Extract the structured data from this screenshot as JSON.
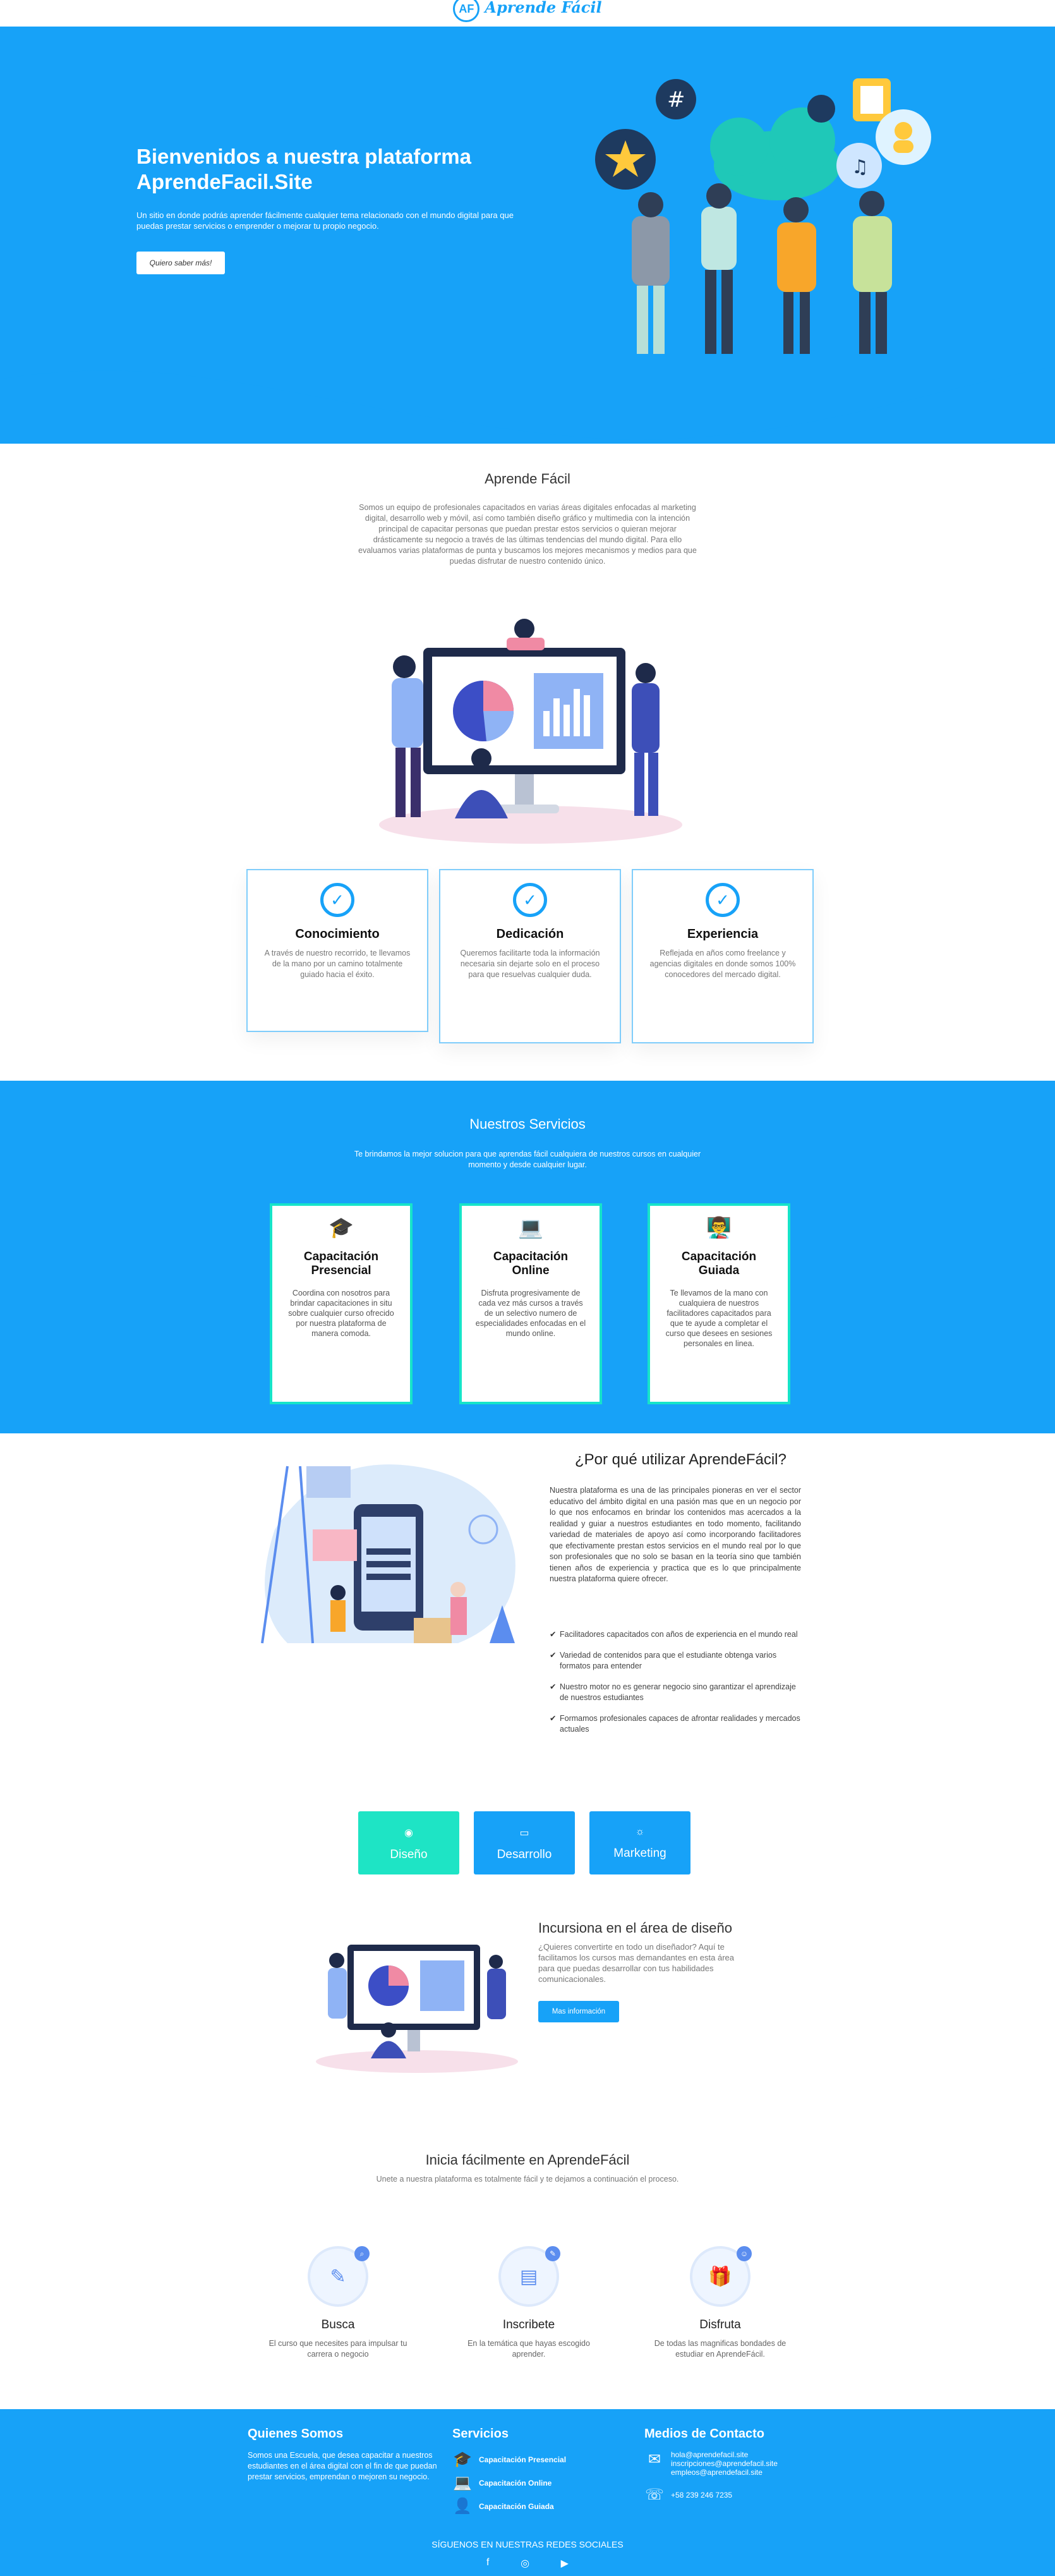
{
  "header": {
    "logo_text": "Aprende Fácil",
    "logo_mark": "AF"
  },
  "hero": {
    "title": "Bienvenidos a nuestra plataforma AprendeFacil.Site",
    "text": "Un sitio en donde podrás aprender fácilmente cualquier tema relacionado con el mundo digital para que puedas prestar servicios o emprender o mejorar tu propio negocio.",
    "button": "Quiero saber más!"
  },
  "about": {
    "title": "Aprende Fácil",
    "text": "Somos un equipo de profesionales capacitados en varias áreas digitales enfocadas al marketing digital, desarrollo web y móvil, así como también diseño gráfico y multimedia con la intención principal de capacitar personas que puedan prestar estos servicios o quieran mejorar drásticamente su negocio a través de las últimas tendencias del mundo digital. Para ello evaluamos varias plataformas de punta y buscamos los mejores mecanismos y medios para que puedas disfrutar de nuestro contenido único."
  },
  "features": [
    {
      "title": "Conocimiento",
      "text": "A través de nuestro recorrido, te llevamos de la mano por un camino totalmente guiado hacia el éxito."
    },
    {
      "title": "Dedicación",
      "text": "Queremos facilitarte toda la información necesaria sin dejarte solo en el proceso para que resuelvas cualquier duda."
    },
    {
      "title": "Experiencia",
      "text": "Reflejada en años como freelance y agencias digitales en donde somos 100% conocedores del mercado digital."
    }
  ],
  "services": {
    "title": "Nuestros Servicios",
    "text": "Te brindamos la mejor solucion para que aprendas fácil cualquiera de nuestros cursos en cualquier momento y desde cualquier lugar.",
    "items": [
      {
        "icon": "graduate-icon",
        "glyph": "🎓",
        "title": "Capacitación Presencial",
        "text": "Coordina con nosotros para brindar capacitaciones in situ sobre cualquier curso ofrecido por nuestra plataforma de manera comoda."
      },
      {
        "icon": "laptop-icon",
        "glyph": "💻",
        "title": "Capacitación Online",
        "text": "Disfruta progresivamente de cada vez más cursos a través de un selectivo numero de especialidades enfocadas en el mundo online."
      },
      {
        "icon": "user-teacher-icon",
        "glyph": "👨‍🏫",
        "title": "Capacitación Guiada",
        "text": "Te llevamos de la mano con cualquiera de nuestros facilitadores capacitados para que te ayude a completar el curso que desees en sesiones personales en linea."
      }
    ]
  },
  "why": {
    "title": "¿Por qué utilizar AprendeFácil?",
    "text": "Nuestra plataforma es una de las principales pioneras en ver el sector educativo del ámbito digital en una pasión mas que en un negocio por lo que nos enfocamos en brindar los contenidos mas acercados a la realidad y guiar a nuestros estudiantes en todo momento, facilitando variedad de materiales de apoyo así como incorporando facilitadores que efectivamente prestan estos servicios en el mundo real por lo que son profesionales que no solo se basan en la teoría sino que también tienen años de experiencia y practica que es lo que principalmente nuestra plataforma quiere ofrecer.",
    "items": [
      "Facilitadores capacitados con años de experiencia en el mundo real",
      "Variedad de contenidos para que el estudiante obtenga varios formatos para entender",
      "Nuestro motor no es generar negocio sino garantizar el aprendizaje de nuestros estudiantes",
      "Formamos profesionales capaces de afrontar realidades y mercados actuales"
    ]
  },
  "tabs": [
    {
      "label": "Diseño",
      "glyph": "◉",
      "color": "#1ee4c5"
    },
    {
      "label": "Desarrollo",
      "glyph": "▭",
      "color": "#17a2f8"
    },
    {
      "label": "Marketing",
      "glyph": "☼",
      "color": "#17a2f8"
    }
  ],
  "design": {
    "title": "Incursiona en el área de diseño",
    "text": "¿Quieres convertirte en todo un diseñador? Aquí te facilitamos los cursos mas demandantes en esta área para que puedas desarrollar con tus habilidades comunicacionales.",
    "button": "Mas información"
  },
  "start": {
    "title": "Inicia fácilmente en AprendeFácil",
    "text": "Unete a nuestra plataforma es totalmente fácil y te dejamos a continuación el proceso.",
    "steps": [
      {
        "title": "Busca",
        "text": "El curso que necesites para impulsar tu carrera o negocio",
        "glyph": "✎",
        "badge": "⌕"
      },
      {
        "title": "Inscribete",
        "text": "En la temática que hayas escogido aprender.",
        "glyph": "▤",
        "badge": "✎"
      },
      {
        "title": "Disfruta",
        "text": "De todas las magnificas bondades de estudiar en AprendeFácil.",
        "glyph": "🎁",
        "badge": "☺"
      }
    ]
  },
  "footer": {
    "about_title": "Quienes Somos",
    "about_text": "Somos una Escuela, que desea capacitar a nuestros estudiantes en el área digital con el fin de que puedan prestar servicios, emprendan o mejoren su negocio.",
    "services_title": "Servicios",
    "services": [
      "Capacitación Presencial",
      "Capacitación Online",
      "Capacitación Guiada"
    ],
    "contact_title": "Medios de Contacto",
    "emails": [
      "hola@aprendefacil.site",
      "inscripciones@aprendefacil.site",
      "empleos@aprendefacil.site"
    ],
    "phone": "+58 239 246 7235",
    "social_title": "SÍGUENOS EN NUESTRAS REDES SOCIALES"
  },
  "colors": {
    "brand": "#17a2f8",
    "teal": "#16e4c9"
  }
}
